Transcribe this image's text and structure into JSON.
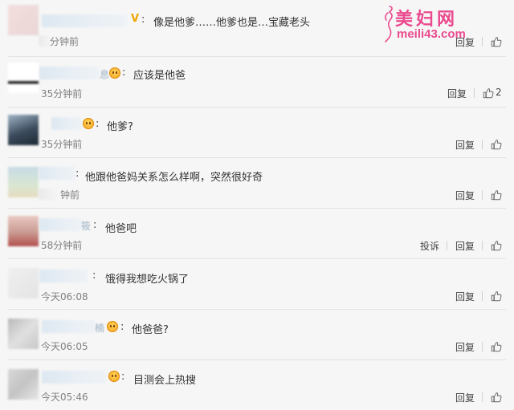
{
  "watermark": {
    "site_name": "美妇网",
    "url": "meili43.com"
  },
  "actions": {
    "reply": "回复",
    "report": "投诉"
  },
  "comments": [
    {
      "name_suffix": "",
      "badge": "v",
      "text": "像是他爹……他爹也是…宝藏老头",
      "time": "分钟前",
      "likes": ""
    },
    {
      "name_suffix": "息",
      "badge": "emoji",
      "text": "应该是他爸",
      "time": "35分钟前",
      "likes": "2"
    },
    {
      "name_suffix": "",
      "badge": "emoji",
      "text": "他爹?",
      "time": "35分钟前",
      "likes": ""
    },
    {
      "name_suffix": "",
      "badge": "",
      "text": "他跟他爸妈关系怎么样啊，突然很好奇",
      "time": "钟前",
      "likes": ""
    },
    {
      "name_suffix": "筱",
      "badge": "",
      "text": "他爸吧",
      "time": "58分钟前",
      "likes": ""
    },
    {
      "name_suffix": "",
      "badge": "",
      "text": "饿得我想吃火锅了",
      "time": "今天06:08",
      "likes": ""
    },
    {
      "name_suffix": "楠",
      "badge": "emoji",
      "text": "他爸爸?",
      "time": "今天06:05",
      "likes": ""
    },
    {
      "name_suffix": "",
      "badge": "emoji",
      "text": "目测会上热搜",
      "time": "今天05:46",
      "likes": ""
    }
  ],
  "colors": {
    "watermark": "#ea4a8e",
    "verified": "#f0a500",
    "divider": "#e2e2e2",
    "background": "#f6f6f6"
  },
  "icons": {
    "like": "thumbs-up-icon",
    "member_badge": "emoji-badge-icon",
    "verified": "v-badge-icon"
  }
}
